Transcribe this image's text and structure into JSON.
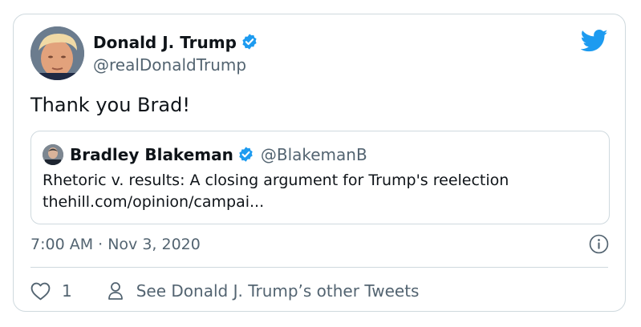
{
  "tweet": {
    "author_name": "Donald J. Trump",
    "author_handle": "@realDonaldTrump",
    "text": "Thank you Brad!",
    "timestamp": "7:00 AM · Nov 3, 2020",
    "like_count": "1",
    "other_tweets_label": "See Donald J. Trump’s other Tweets"
  },
  "quoted": {
    "author_name": "Bradley Blakeman",
    "author_handle": "@BlakemanB",
    "text": "Rhetoric v. results: A closing argument for Trump's reelection",
    "link": "thehill.com/opinion/campai..."
  },
  "icons": {
    "verified": "verified-badge-icon",
    "brand": "twitter-bird-icon",
    "info": "info-icon",
    "like": "heart-icon",
    "profile": "person-icon"
  },
  "colors": {
    "twitter_blue": "#1d9bf0",
    "secondary_text": "#536471",
    "border": "#cfd9de"
  }
}
